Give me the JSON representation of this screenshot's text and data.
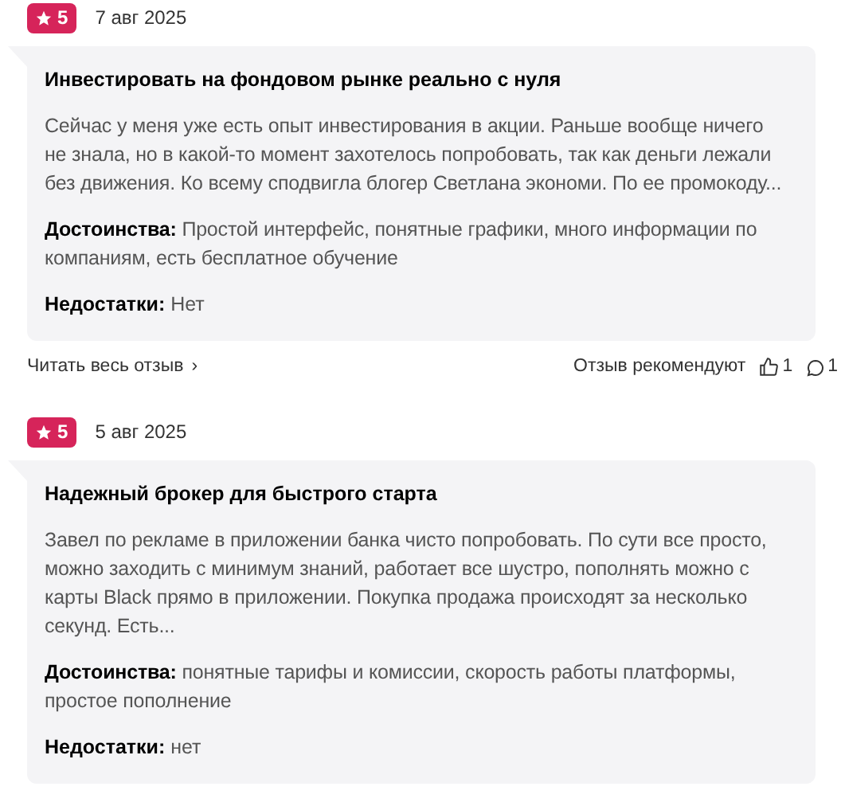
{
  "reviews": [
    {
      "rating": "5",
      "date": "7 авг 2025",
      "title": "Инвестировать на фондовом рынке реально с нуля",
      "text": "Сейчас у меня уже есть опыт инвестирования в акции. Раньше вообще ничего не знала, но в какой-то момент захотелось попробовать, так как деньги лежали без движения. Ко всему сподвигла блогер Светлана экономи. По ее промокоду...",
      "pros": "**Достоинства:** Простой интерфейс, понятные графики, много информации по компаниям, есть бесплатное обучение",
      "cons": "**Недостатки:** Нет",
      "footer": {
        "read_more": "Читать весь отзыв",
        "arrow": "›",
        "recommend": "Отзыв рекомендуют",
        "likes": "1",
        "comments": "1"
      }
    },
    {
      "rating": "5",
      "date": "5 авг 2025",
      "title": "Надежный брокер для быстрого старта",
      "text": "Завел по рекламе в приложении банка чисто попробовать. По сути все просто, можно заходить с минимум знаний, работает все шустро, пополнять можно с карты Black прямо в приложении. Покупка продажа происходят за несколько секунд. Есть...",
      "pros": "**Достоинства:** понятные тарифы и комиссии, скорость работы платформы, простое пополнение",
      "cons": "**Недостатки:** нет"
    }
  ]
}
